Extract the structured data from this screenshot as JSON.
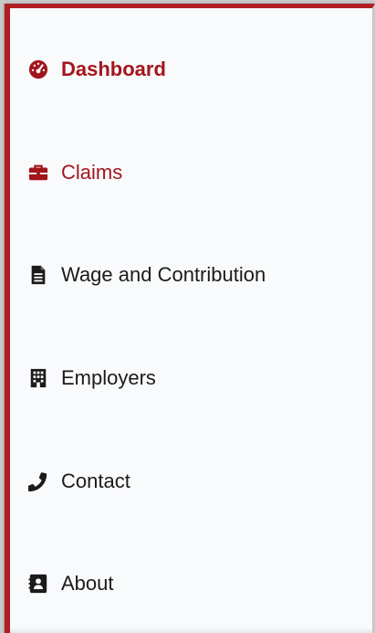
{
  "nav": {
    "items": [
      {
        "label": "Dashboard",
        "icon": "tachometer-icon",
        "state": "active"
      },
      {
        "label": "Claims",
        "icon": "briefcase-icon",
        "state": "highlighted"
      },
      {
        "label": "Wage and Contribution",
        "icon": "document-icon",
        "state": "default"
      },
      {
        "label": "Employers",
        "icon": "building-icon",
        "state": "default"
      },
      {
        "label": "Contact",
        "icon": "phone-icon",
        "state": "default"
      },
      {
        "label": "About",
        "icon": "address-card-icon",
        "state": "default"
      }
    ]
  },
  "colors": {
    "accent": "#b01e23",
    "active_text": "#a3151d",
    "text": "#1b1b1b",
    "panel_bg": "#f8fafc"
  }
}
